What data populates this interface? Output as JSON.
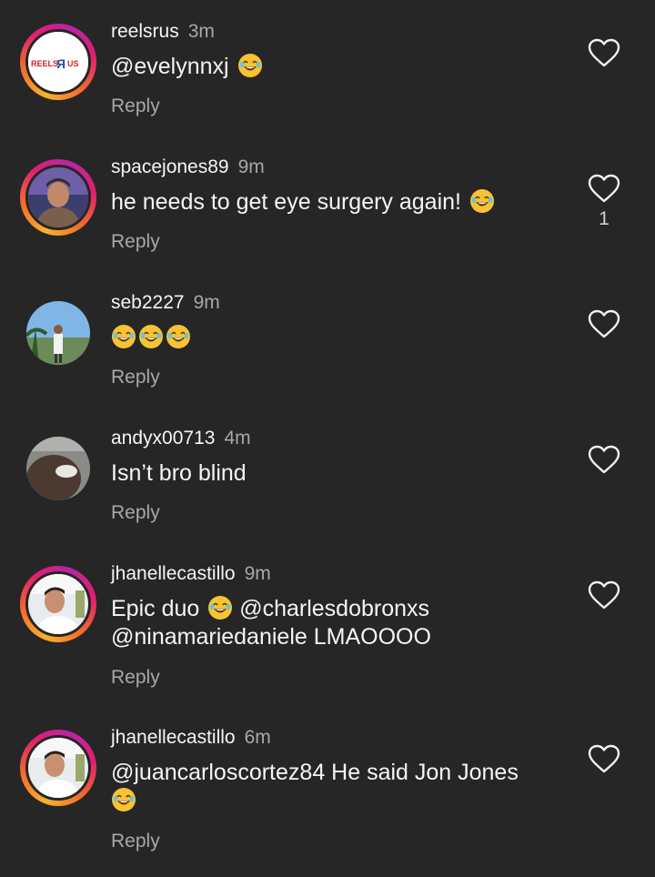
{
  "comments": [
    {
      "username": "reelsrus",
      "time": "3m",
      "text": "@evelynnxj",
      "emoji": "😂",
      "reply": "Reply",
      "avatar_text": "REELS ЯUS"
    },
    {
      "username": "spacejones89",
      "time": "9m",
      "text": "he needs to get eye surgery again!",
      "emoji": "😂",
      "reply": "Reply",
      "likes": "1"
    },
    {
      "username": "seb2227",
      "time": "9m",
      "text": "",
      "emoji": "😂😂😂",
      "reply": "Reply"
    },
    {
      "username": "andyx00713",
      "time": "4m",
      "text": "Isn’t bro blind",
      "reply": "Reply"
    },
    {
      "username": "jhanellecastillo",
      "time": "9m",
      "text_before": "Epic duo",
      "emoji": "😂",
      "text_line1_after": "@charlesdobronxs",
      "text_line2": "@ninamariedaniele LMAOOOO",
      "reply": "Reply"
    },
    {
      "username": "jhanellecastillo",
      "time": "6m",
      "text": "@juancarloscortez84 He said Jon Jones",
      "emoji": "😂",
      "reply": "Reply"
    }
  ],
  "colors": {
    "background": "#262626",
    "primary_text": "#f5f5f5",
    "secondary_text": "#a8a8a8",
    "story_ring_start": "#f8b12f",
    "story_ring_end": "#b825a6"
  },
  "icons": {
    "like": "heart-outline-icon",
    "emoji": "face-with-tears-of-joy"
  }
}
